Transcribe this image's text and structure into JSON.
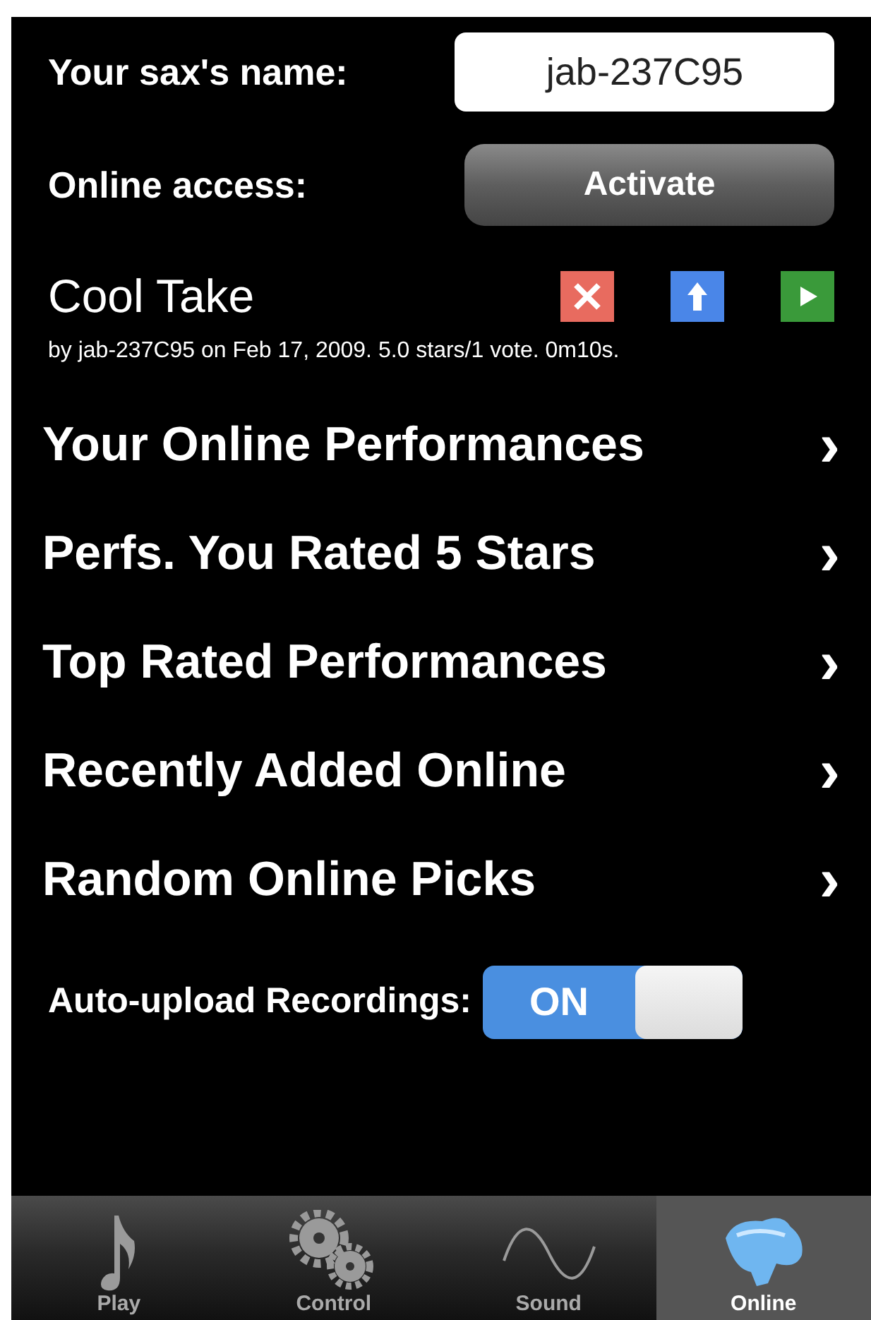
{
  "name_field": {
    "label": "Your sax's name:",
    "value": "jab-237C95"
  },
  "online_access": {
    "label": "Online access:",
    "button": "Activate"
  },
  "current_take": {
    "title": "Cool Take",
    "details": "by jab-237C95 on Feb 17, 2009. 5.0 stars/1 vote. 0m10s."
  },
  "menu_items": [
    {
      "label": "Your Online Performances",
      "chevron": "›"
    },
    {
      "label": "Perfs. You Rated 5 Stars",
      "chevron": "›"
    },
    {
      "label": "Top Rated Performances",
      "chevron": "›"
    },
    {
      "label": "Recently Added Online",
      "chevron": "›"
    },
    {
      "label": "Random Online Picks",
      "chevron": "›"
    }
  ],
  "auto_upload": {
    "label": "Auto-upload Recordings:",
    "on": true,
    "on_text": "ON"
  },
  "tabs": [
    {
      "kind": "note",
      "label": "Play",
      "selected": false
    },
    {
      "kind": "gears",
      "label": "Control",
      "selected": false
    },
    {
      "kind": "wave",
      "label": "Sound",
      "selected": false
    },
    {
      "kind": "creature",
      "label": "Online",
      "selected": true
    }
  ]
}
